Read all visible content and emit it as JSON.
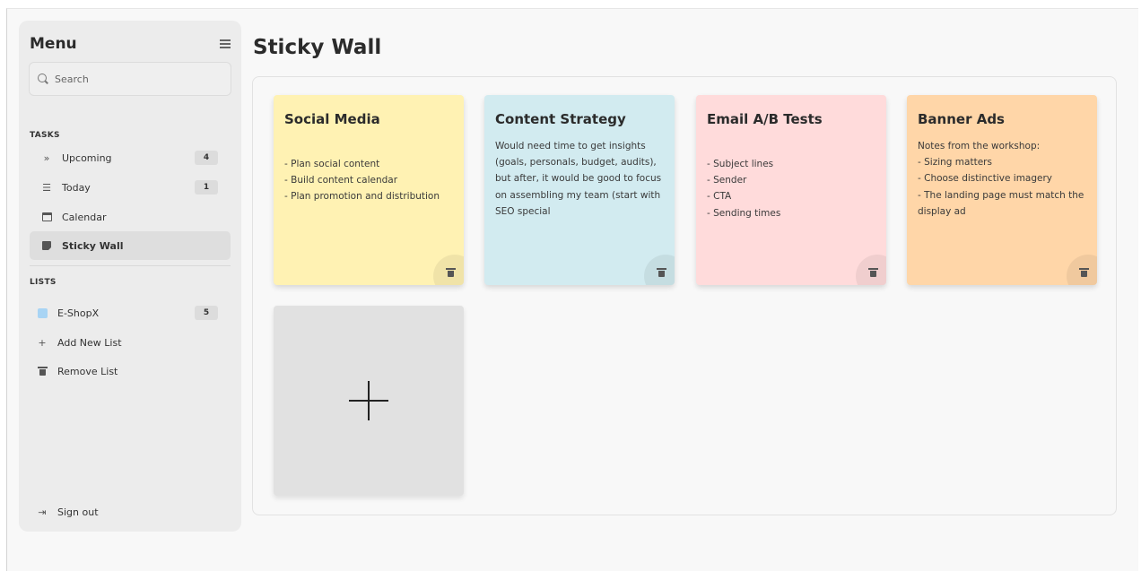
{
  "sidebar": {
    "title": "Menu",
    "search_placeholder": "Search",
    "tasks_label": "TASKS",
    "tasks": [
      {
        "label": "Upcoming",
        "icon": "double-chevron-right-icon",
        "count": "4"
      },
      {
        "label": "Today",
        "icon": "checklist-icon",
        "count": "1"
      },
      {
        "label": "Calendar",
        "icon": "calendar-icon"
      },
      {
        "label": "Sticky Wall",
        "icon": "sticky-note-icon",
        "active": true
      }
    ],
    "lists_label": "LISTS",
    "lists": [
      {
        "label": "E-ShopX",
        "color": "#a8d4f4",
        "count": "5"
      }
    ],
    "add_list_label": "Add New List",
    "remove_list_label": "Remove List",
    "sign_out_label": "Sign out"
  },
  "main": {
    "title": "Sticky Wall",
    "notes": [
      {
        "title": "Social Media",
        "color": "#fff2b3",
        "lines": [
          "- Plan social content",
          "- Build content calendar",
          "- Plan promotion and distribution"
        ]
      },
      {
        "title": "Content Strategy",
        "color": "#d2ebf0",
        "lines": [
          "Would need time to get insights",
          "(goals, personals, budget, audits),",
          "but after, it would be good to focus",
          "on assembling my team (start with",
          "SEO special"
        ]
      },
      {
        "title": "Email A/B Tests",
        "color": "#ffdbdb",
        "lines": [
          "- Subject lines",
          "- Sender",
          "- CTA",
          "- Sending times"
        ]
      },
      {
        "title": "Banner Ads",
        "color": "#ffd6a8",
        "lines": [
          "Notes from the workshop:",
          "- Sizing matters",
          "- Choose distinctive imagery",
          "- The landing page must match the",
          "display ad"
        ]
      }
    ],
    "add_note_color": "#e1e1e1"
  }
}
